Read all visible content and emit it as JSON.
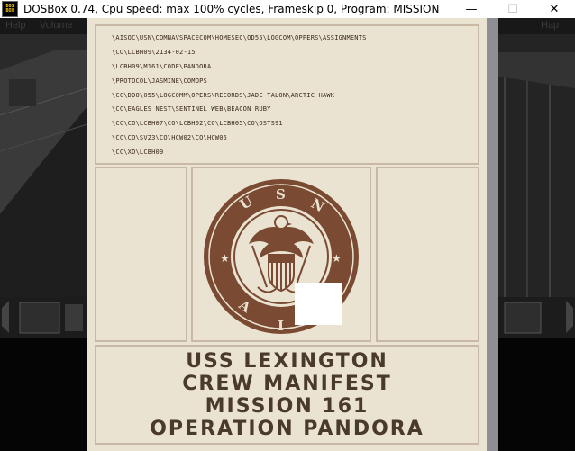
{
  "window": {
    "title": "DOSBox 0.74, Cpu speed: max 100% cycles, Frameskip  0, Program:  MISSION",
    "icon_top": "DOS",
    "icon_bottom": "BOX",
    "minimize_glyph": "—",
    "maximize_glyph": "☐",
    "close_glyph": "✕"
  },
  "menu": {
    "help": "Help",
    "volume": "Volume",
    "right": "Hap"
  },
  "document": {
    "path_lines": [
      "\\AISOC\\USN\\COMNAVSPACECOM\\HOMESEC\\OD55\\LOGCOM\\OPPERS\\ASSIGNMENTS",
      "\\CO\\LCBH09\\2134-02-15",
      "\\LCBH09\\M161\\CODE\\PANDORA",
      "\\PROTOCOL\\JASMINE\\COMOPS",
      "\\CC\\DDO\\055\\LOGCOMM\\OPERS\\RECORDS\\JADE TALON\\ARCTIC HAWK",
      "\\CC\\EAGLES NEST\\SENTINEL WEB\\BEACON RUBY",
      "\\CC\\CO\\LCBH07\\CO\\LCBH02\\CO\\LCBH05\\CO\\OSTS91",
      "\\CC\\CO\\SV23\\CO\\HCW02\\CO\\HCW05",
      "\\CC\\XO\\LCBH09"
    ],
    "seal": {
      "top_text": "USN",
      "bottom_text": "AIS"
    },
    "title_lines": [
      "USS LEXINGTON",
      "CREW MANIFEST",
      "MISSION 161",
      "OPERATION PANDORA"
    ]
  },
  "colors": {
    "paper": "#ebe3d2",
    "ink_brown": "#7a4a32",
    "title_text": "#4a3a2c"
  }
}
